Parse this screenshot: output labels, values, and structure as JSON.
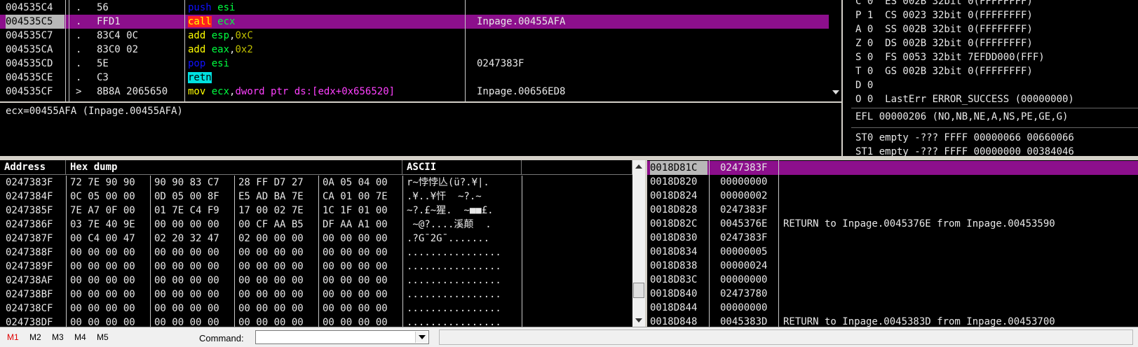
{
  "colors": {
    "mnemonic": "#ffff00",
    "push_pop": "#1010ff",
    "call_bg": "#ff2020",
    "call_fg": "#ffff00",
    "retn_bg": "#00e0e0",
    "reg": "#00ff40",
    "const": "#c0c000",
    "ptr": "#ff40ff",
    "selection": "#8c0f8c"
  },
  "disasm": {
    "rows": [
      {
        "addr": "004535C4",
        "mark": ".",
        "hex": "56",
        "ops": [
          {
            "t": "push",
            "c": "push_pop"
          },
          {
            "t": " "
          },
          {
            "t": "esi",
            "c": "reg"
          }
        ],
        "comment": ""
      },
      {
        "addr": "004535C5",
        "mark": ".",
        "hex": "FFD1",
        "ops": [
          {
            "t": "call",
            "c": "call"
          },
          {
            "t": " "
          },
          {
            "t": "ecx",
            "c": "reg"
          }
        ],
        "comment": "Inpage.00455AFA",
        "selected": true
      },
      {
        "addr": "004535C7",
        "mark": ".",
        "hex": "83C4 0C",
        "ops": [
          {
            "t": "add",
            "c": "mnemonic"
          },
          {
            "t": " "
          },
          {
            "t": "esp",
            "c": "reg"
          },
          {
            "t": ",",
            "c": "plain"
          },
          {
            "t": "0xC",
            "c": "const"
          }
        ],
        "comment": ""
      },
      {
        "addr": "004535CA",
        "mark": ".",
        "hex": "83C0 02",
        "ops": [
          {
            "t": "add",
            "c": "mnemonic"
          },
          {
            "t": " "
          },
          {
            "t": "eax",
            "c": "reg"
          },
          {
            "t": ",",
            "c": "plain"
          },
          {
            "t": "0x2",
            "c": "const"
          }
        ],
        "comment": ""
      },
      {
        "addr": "004535CD",
        "mark": ".",
        "hex": "5E",
        "ops": [
          {
            "t": "pop",
            "c": "push_pop"
          },
          {
            "t": " "
          },
          {
            "t": "esi",
            "c": "reg"
          }
        ],
        "comment": "0247383F"
      },
      {
        "addr": "004535CE",
        "mark": ".",
        "hex": "C3",
        "ops": [
          {
            "t": "retn",
            "c": "retn"
          }
        ],
        "comment": ""
      },
      {
        "addr": "004535CF",
        "mark": ">",
        "hex": "8B8A 2065650",
        "ops": [
          {
            "t": "mov",
            "c": "mnemonic"
          },
          {
            "t": " "
          },
          {
            "t": "ecx",
            "c": "reg"
          },
          {
            "t": ",",
            "c": "plain"
          },
          {
            "t": "dword ptr",
            "c": "ptr"
          },
          {
            "t": " "
          },
          {
            "t": "ds:[edx+0x656520]",
            "c": "ptr"
          }
        ],
        "comment": "Inpage.00656ED8"
      }
    ]
  },
  "info_line": "ecx=00455AFA (Inpage.00455AFA)",
  "registers": {
    "flags": [
      {
        "text": "C 0  ES 002B 32bit 0(FFFFFFFF)"
      },
      {
        "text": "P 1  CS 0023 32bit 0(FFFFFFFF)"
      },
      {
        "text": "A 0  SS 002B 32bit 0(FFFFFFFF)"
      },
      {
        "text": "Z 0  DS 002B 32bit 0(FFFFFFFF)"
      },
      {
        "text": "S 0  FS 0053 32bit 7EFDD000(FFF)"
      },
      {
        "text": "T 0  GS 002B 32bit 0(FFFFFFFF)"
      },
      {
        "text": "D 0"
      },
      {
        "text": "O 0  LastErr ERROR_SUCCESS (00000000)"
      }
    ],
    "efl": "EFL 00000206 (NO,NB,NE,A,NS,PE,GE,G)",
    "st": [
      "ST0 empty -??? FFFF 00000066 00660066",
      "ST1 empty -??? FFFF 00000000 00384046"
    ]
  },
  "dump": {
    "headers": {
      "address": "Address",
      "hex": "Hex dump",
      "ascii": "ASCII"
    },
    "rows": [
      {
        "addr": "0247383F",
        "g": [
          "72 7E 90 90",
          "90 90 83 C7",
          "28 FF D7 27",
          "0A 05 04 00"
        ],
        "ascii": "r~悖悖亾(ü?.¥|."
      },
      {
        "addr": "0247384F",
        "g": [
          "0C 05 00 00",
          "0D 05 00 8F",
          "E5 AD BA 7E",
          "CA 01 00 7E"
        ],
        "ascii": ".¥..¥忓  ~?.~"
      },
      {
        "addr": "0247385F",
        "g": [
          "7E A7 0F 00",
          "01 7E C4 F9",
          "17 00 02 7E",
          "1C 1F 01 00"
        ],
        "ascii": "~?.£~猩.  ~■■£."
      },
      {
        "addr": "0247386F",
        "g": [
          "03 7E 40 9E",
          "00 00 00 00",
          "00 CF AA B5",
          "DF AA A1 00"
        ],
        "ascii": " ~@?....溪颠  ."
      },
      {
        "addr": "0247387F",
        "g": [
          "00 C4 00 47",
          "02 20 32 47",
          "02 00 00 00",
          "00 00 00 00"
        ],
        "ascii": ".?G¯2G¯......."
      },
      {
        "addr": "0247388F",
        "g": [
          "00 00 00 00",
          "00 00 00 00",
          "00 00 00 00",
          "00 00 00 00"
        ],
        "ascii": "................"
      },
      {
        "addr": "0247389F",
        "g": [
          "00 00 00 00",
          "00 00 00 00",
          "00 00 00 00",
          "00 00 00 00"
        ],
        "ascii": "................"
      },
      {
        "addr": "024738AF",
        "g": [
          "00 00 00 00",
          "00 00 00 00",
          "00 00 00 00",
          "00 00 00 00"
        ],
        "ascii": "................"
      },
      {
        "addr": "024738BF",
        "g": [
          "00 00 00 00",
          "00 00 00 00",
          "00 00 00 00",
          "00 00 00 00"
        ],
        "ascii": "................"
      },
      {
        "addr": "024738CF",
        "g": [
          "00 00 00 00",
          "00 00 00 00",
          "00 00 00 00",
          "00 00 00 00"
        ],
        "ascii": "................"
      },
      {
        "addr": "024738DF",
        "g": [
          "00 00 00 00",
          "00 00 00 00",
          "00 00 00 00",
          "00 00 00 00"
        ],
        "ascii": "................"
      }
    ]
  },
  "stack": {
    "rows": [
      {
        "addr": "0018D81C",
        "val": "0247383F",
        "comment": "",
        "selected": true
      },
      {
        "addr": "0018D820",
        "val": "00000000",
        "comment": ""
      },
      {
        "addr": "0018D824",
        "val": "00000002",
        "comment": ""
      },
      {
        "addr": "0018D828",
        "val": "0247383F",
        "comment": ""
      },
      {
        "addr": "0018D82C",
        "val": "0045376E",
        "comment": "RETURN to Inpage.0045376E from Inpage.00453590"
      },
      {
        "addr": "0018D830",
        "val": "0247383F",
        "comment": ""
      },
      {
        "addr": "0018D834",
        "val": "00000005",
        "comment": ""
      },
      {
        "addr": "0018D838",
        "val": "00000024",
        "comment": ""
      },
      {
        "addr": "0018D83C",
        "val": "00000000",
        "comment": ""
      },
      {
        "addr": "0018D840",
        "val": "02473780",
        "comment": ""
      },
      {
        "addr": "0018D844",
        "val": "00000000",
        "comment": ""
      },
      {
        "addr": "0018D848",
        "val": "0045383D",
        "comment": "RETURN to Inpage.0045383D from Inpage.00453700"
      }
    ]
  },
  "statusbar": {
    "tabs": [
      {
        "label": "M1",
        "active": true
      },
      {
        "label": "M2"
      },
      {
        "label": "M3"
      },
      {
        "label": "M4"
      },
      {
        "label": "M5"
      }
    ],
    "command_label": "Command:",
    "command_value": ""
  }
}
